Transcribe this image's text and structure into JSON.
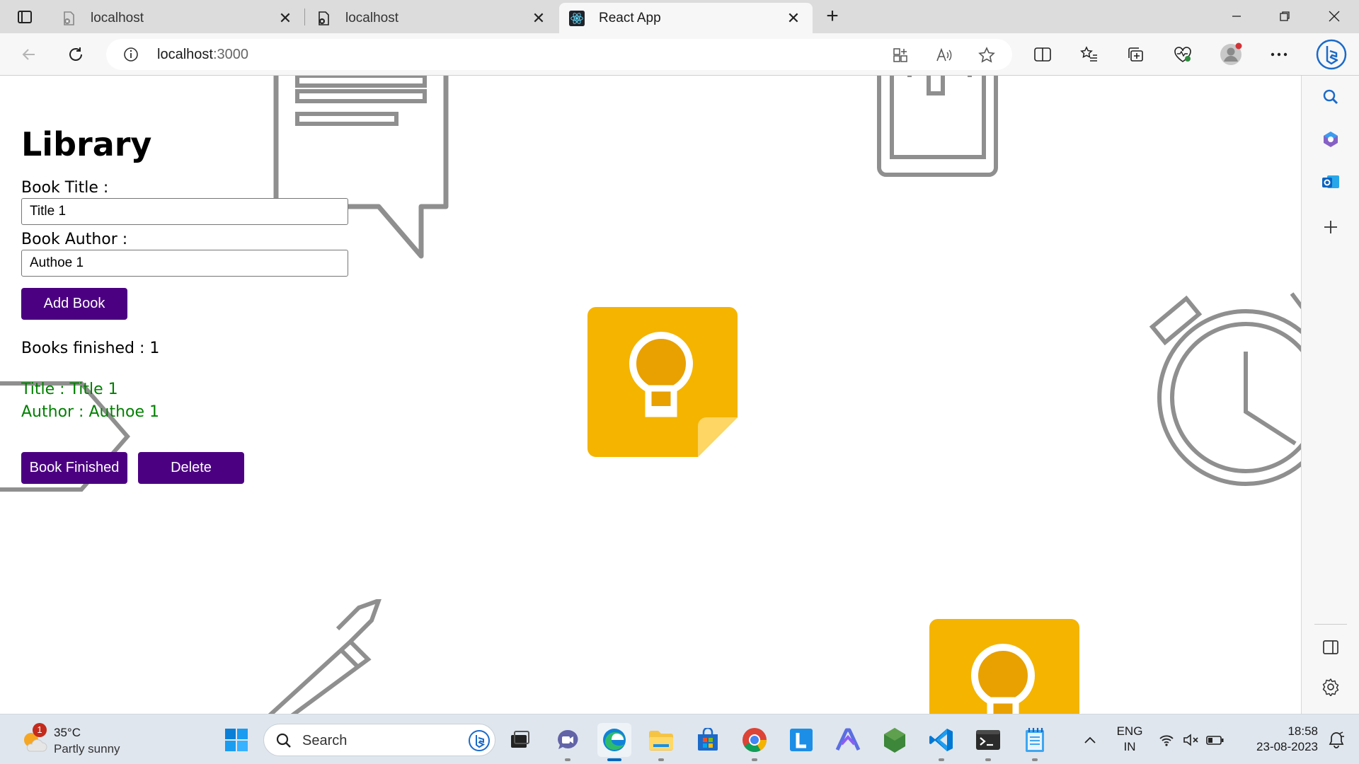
{
  "browser": {
    "tabs": [
      {
        "title": "localhost",
        "active": false
      },
      {
        "title": "localhost",
        "active": false
      },
      {
        "title": "React App",
        "active": true
      }
    ],
    "address": {
      "host": "localhost",
      "port": ":3000"
    }
  },
  "app": {
    "heading": "Library",
    "title_label": "Book Title :",
    "title_value": "Title 1",
    "author_label": "Book Author :",
    "author_value": "Authoe 1",
    "add_button": "Add Book",
    "finished_text": "Books finished : 1",
    "books": [
      {
        "title_line": "Title : Title 1",
        "author_line": "Author : Authoe 1",
        "finish_button": "Book Finished",
        "delete_button": "Delete"
      }
    ],
    "colors": {
      "button": "#4b0082",
      "book_text": "#008000"
    }
  },
  "taskbar": {
    "weather": {
      "temp": "35°C",
      "condition": "Partly sunny",
      "badge": "1"
    },
    "search_placeholder": "Search",
    "language": {
      "line1": "ENG",
      "line2": "IN"
    },
    "clock": {
      "time": "18:58",
      "date": "23-08-2023"
    }
  }
}
